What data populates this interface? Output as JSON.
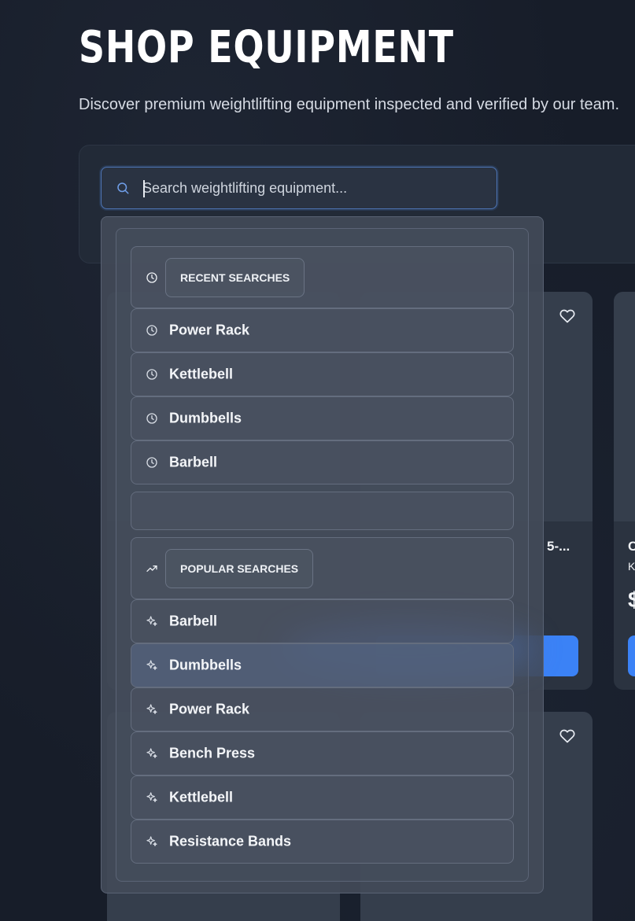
{
  "header": {
    "title": "SHOP EQUIPMENT",
    "subtitle": "Discover premium weightlifting equipment inspected and verified by our team."
  },
  "search": {
    "placeholder": "Search weightlifting equipment...",
    "value": ""
  },
  "recent": {
    "heading": "RECENT SEARCHES",
    "items": [
      "Power Rack",
      "Kettlebell",
      "Dumbbells",
      "Barbell"
    ]
  },
  "popular": {
    "heading": "POPULAR SEARCHES",
    "items": [
      "Barbell",
      "Dumbbells",
      "Power Rack",
      "Bench Press",
      "Kettlebell",
      "Resistance Bands"
    ],
    "highlighted": "Dumbbells"
  },
  "cards": [
    {
      "name_fragment": "5-..."
    },
    {
      "name_fragment": "C",
      "sub_fragment": "K",
      "price_fragment": "$"
    }
  ],
  "colors": {
    "accent": "#3b82f6",
    "background": "#171d29",
    "dropdown": "#424a58"
  },
  "icons": {
    "search": "search-icon",
    "recent": "clock-icon",
    "popular": "trending-up-icon",
    "popular_item": "sparkle-icon",
    "favorite": "heart-icon"
  }
}
